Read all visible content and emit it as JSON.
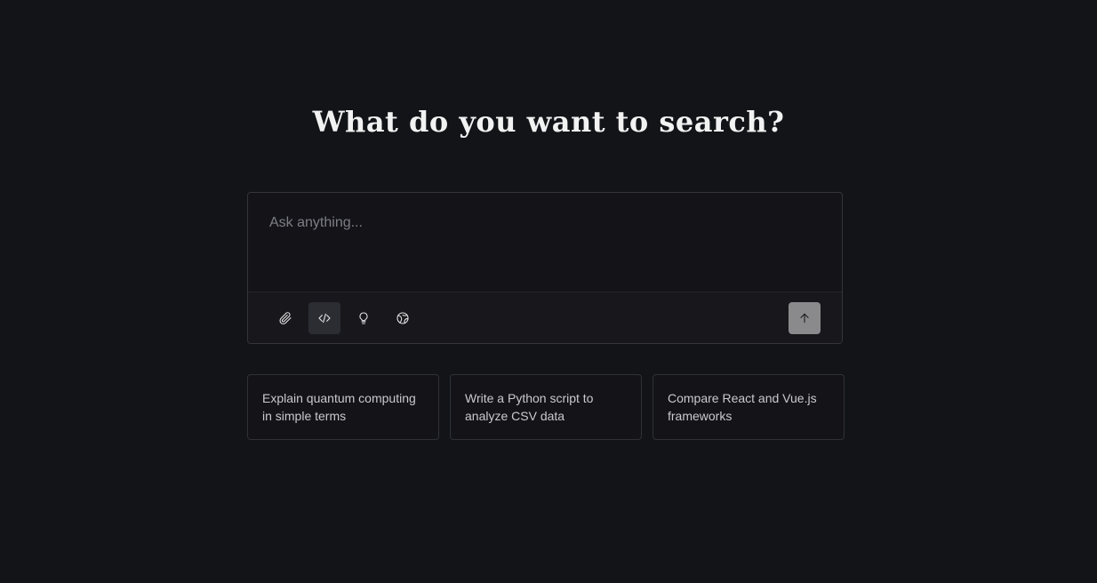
{
  "headline": "What do you want to search?",
  "composer": {
    "placeholder": "Ask anything...",
    "tools": [
      {
        "name": "attach",
        "icon": "paperclip-icon"
      },
      {
        "name": "code",
        "icon": "code-icon",
        "active": true
      },
      {
        "name": "think",
        "icon": "lightbulb-icon"
      },
      {
        "name": "web",
        "icon": "globe-icon"
      }
    ],
    "send_icon": "arrow-up-icon"
  },
  "suggestions": [
    {
      "text": "Explain quantum computing in simple terms"
    },
    {
      "text": "Write a Python script to analyze CSV data"
    },
    {
      "text": "Compare React and Vue.js frameworks"
    }
  ],
  "colors": {
    "background": "#131418",
    "border": "#34353b",
    "send_button": "#8a8a8d",
    "active_tool": "#2c2d32"
  }
}
